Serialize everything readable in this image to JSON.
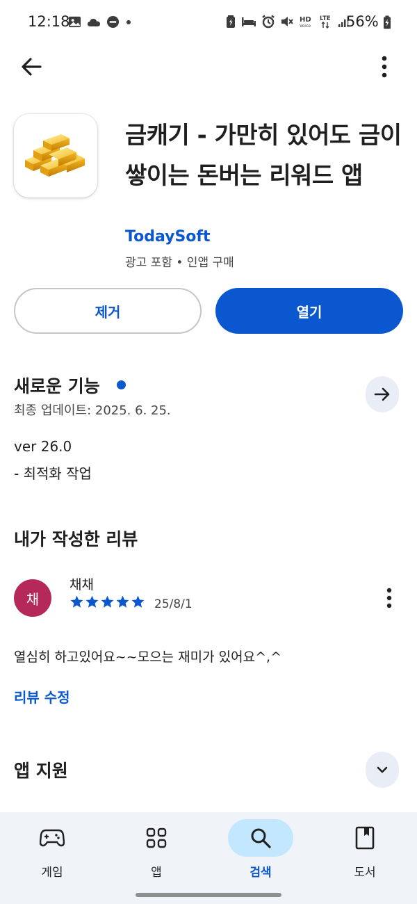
{
  "status_bar": {
    "time": "12:18",
    "battery_percent": "56%",
    "network": "LTE",
    "hd_label": "HD",
    "voice_label": "Voice",
    "icons": [
      "gallery-icon",
      "cloud-icon",
      "dnd-icon",
      "dot-icon",
      "battery-saver-icon",
      "sleep-icon",
      "alarm-icon",
      "mute-icon",
      "hd-voice-icon",
      "lte-icon",
      "signal-icon",
      "battery-icon"
    ]
  },
  "top_bar": {
    "back_icon": "arrow-back-icon",
    "more_icon": "more-vert-icon"
  },
  "app": {
    "title": "금캐기 - 가만히 있어도 금이 쌓이는 돈버는 리워드 앱",
    "developer": "TodaySoft",
    "meta": "광고 포함  •  인앱 구매",
    "icon": "gold-bars-icon"
  },
  "actions": {
    "remove_label": "제거",
    "open_label": "열기"
  },
  "whats_new": {
    "title": "새로운 기능",
    "updated": "최종 업데이트: 2025. 6. 25.",
    "version": "ver 26.0",
    "note": "- 최적화 작업"
  },
  "my_review": {
    "title": "내가 작성한 리뷰",
    "avatar_initial": "채",
    "author": "채채",
    "rating": 5,
    "date": "25/8/1",
    "text": "열심히 하고있어요~~모으는 재미가 있어요^,^",
    "edit_label": "리뷰 수정"
  },
  "support": {
    "title": "앱 지원"
  },
  "bottom_nav": {
    "items": [
      {
        "label": "게임",
        "icon": "gamepad-icon"
      },
      {
        "label": "앱",
        "icon": "apps-grid-icon"
      },
      {
        "label": "검색",
        "icon": "search-icon",
        "active": true
      },
      {
        "label": "도서",
        "icon": "book-icon"
      }
    ]
  },
  "colors": {
    "accent": "#0b57d0",
    "avatar": "#b5285a",
    "nav_active_pill": "#c2e7ff",
    "nav_background": "#f0f4f9"
  }
}
